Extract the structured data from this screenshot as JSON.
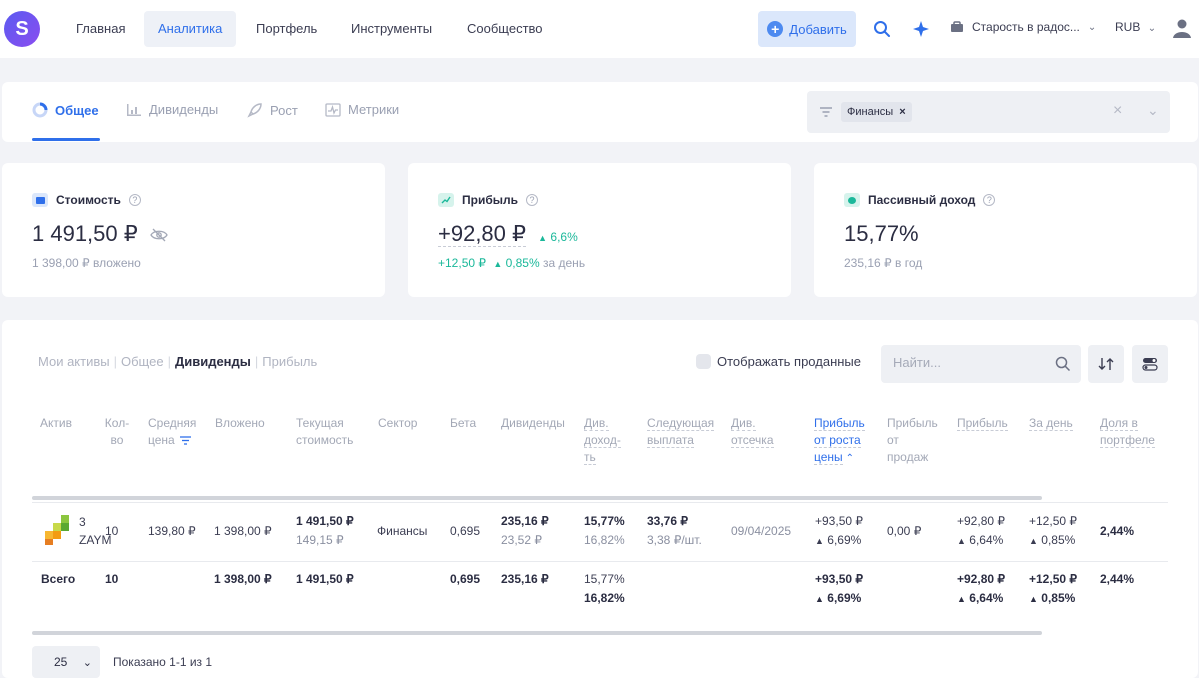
{
  "nav": {
    "logo_letter": "S",
    "items": [
      "Главная",
      "Аналитика",
      "Портфель",
      "Инструменты",
      "Сообщество"
    ],
    "add_label": "Добавить",
    "account": "Старость в радос...",
    "currency": "RUB"
  },
  "tabs": [
    "Общее",
    "Дивиденды",
    "Рост",
    "Метрики"
  ],
  "filter": {
    "chip": "Финансы"
  },
  "cards": {
    "value": {
      "title": "Стоимость",
      "amount": "1 491,50 ₽",
      "sub": "1 398,00 ₽ вложено"
    },
    "profit": {
      "title": "Прибыль",
      "amount": "+92,80 ₽",
      "change": "6,6%",
      "sub_amount": "+12,50 ₽",
      "sub_pct": "0,85%",
      "sub_text": "за день"
    },
    "passive": {
      "title": "Пассивный доход",
      "amount": "15,77%",
      "sub": "235,16 ₽ в год"
    }
  },
  "table": {
    "views": [
      "Мои активы",
      "Общее",
      "Дивиденды",
      "Прибыль"
    ],
    "show_sold": "Отображать проданные",
    "search_placeholder": "Найти...",
    "headers": {
      "asset": "Актив",
      "qty": "Кол-\nво",
      "avg": "Средняя\nцена",
      "invested": "Вложено",
      "current": "Текущая\nстоимость",
      "sector": "Сектор",
      "beta": "Бета",
      "divs": "Дивиденды",
      "divyield": "Див.\nдоход-\nть",
      "next": "Следующая\nвыплата",
      "cutoff": "Див.\nотсечка",
      "growth": "Прибыль\nот роста\nцены",
      "sales": "Прибыль\nот\nпродаж",
      "profit": "Прибыль",
      "day": "За день",
      "share": "Доля в\nпортфеле"
    },
    "row": {
      "ticker_line1": "3",
      "ticker_line2": "ZAYM",
      "qty": "10",
      "avg": "139,80 ₽",
      "invested": "1 398,00 ₽",
      "current": "1 491,50 ₽",
      "current_sub": "149,15 ₽",
      "sector": "Финансы",
      "beta": "0,695",
      "divs": "235,16 ₽",
      "divs_sub": "23,52 ₽",
      "divyield": "15,77%",
      "divyield_sub": "16,82%",
      "next": "33,76 ₽",
      "next_sub": "3,38 ₽/шт.",
      "cutoff": "09/04/2025",
      "growth": "+93,50 ₽",
      "growth_pct": "6,69%",
      "sales": "0,00 ₽",
      "profit": "+92,80 ₽",
      "profit_pct": "6,64%",
      "day": "+12,50 ₽",
      "day_pct": "0,85%",
      "share": "2,44%"
    },
    "total": {
      "label": "Всего",
      "qty": "10",
      "invested": "1 398,00 ₽",
      "current": "1 491,50 ₽",
      "beta": "0,695",
      "divs": "235,16 ₽",
      "divyield": "15,77%",
      "divyield_sub": "16,82%",
      "growth": "+93,50 ₽",
      "growth_pct": "6,69%",
      "profit": "+92,80 ₽",
      "profit_pct": "6,64%",
      "day": "+12,50 ₽",
      "day_pct": "0,85%",
      "share": "2,44%"
    },
    "page_size": "25",
    "shown": "Показано 1-1 из 1"
  },
  "colors": {
    "accent": "#2f6fea",
    "positive": "#1bb89a"
  }
}
